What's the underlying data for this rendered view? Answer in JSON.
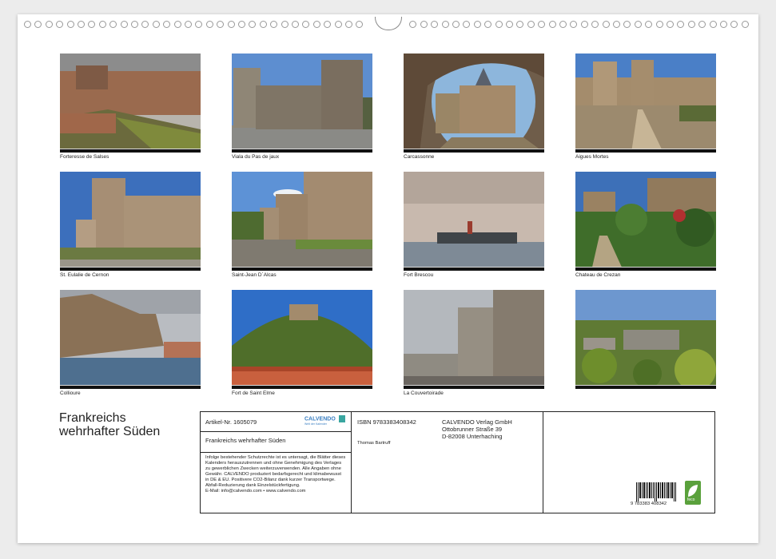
{
  "photos": [
    {
      "caption": "Forteresse de Salses"
    },
    {
      "caption": "Viala du Pas de jaux"
    },
    {
      "caption": "Carcassonne"
    },
    {
      "caption": "Aigues Mortes"
    },
    {
      "caption": "St. Eulalie de Cernon"
    },
    {
      "caption": "Saint-Jean D´Alcas"
    },
    {
      "caption": "Fort Brescou"
    },
    {
      "caption": "Chateau de Crezan"
    },
    {
      "caption": "Collioure"
    },
    {
      "caption": "Fort de Saint Elme"
    },
    {
      "caption": "La Couvertoirade"
    },
    {
      "caption": ""
    }
  ],
  "title": {
    "line1": "Frankreichs",
    "line2": "wehrhafter Süden"
  },
  "info": {
    "article": "Artikel-Nr. 1605079",
    "brand": "CALVENDO",
    "brand_tagline": "Welt der Kalender",
    "book_title": "Frankreichs wehrhafter Süden",
    "legal": "Infolge bestehender Schutzrechte ist es untersagt, die Blätter dieses Kalenders herauszutrennen und ohne Genehmigung des Verlages zu gewerblichen Zwecken weiterzuverwenden. Alle Angaben ohne Gewähr. CALVENDO produziert bedarfsgerecht und klimabewusst in DE & EU. Positivere CO2-Bilanz dank kurzer Transportwege. Abfall-Reduzierung dank Einzelstückfertigung.",
    "email": "E-Mail: info@calvendo.com • www.calvendo.com",
    "isbn": "ISBN 9783383408342",
    "author": "Thomas Bartruff",
    "publisher_name": "CALVENDO Verlag GmbH",
    "publisher_street": "Ottobrunner Straße 39",
    "publisher_city": "D-82008 Unterhaching",
    "barcode_number": "9 783383 408342",
    "eco_label": "feco"
  }
}
